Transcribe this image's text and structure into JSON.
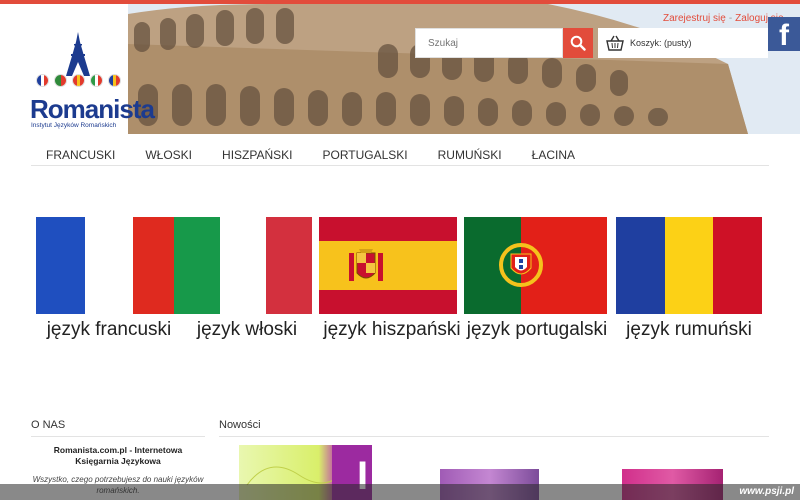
{
  "header": {
    "logo_name": "Romanista",
    "logo_sub": "Instytut Języków Romańskich",
    "logo_flags": [
      {
        "name": "france",
        "colors": [
          "#1f3f9e",
          "#ffffff",
          "#e23a2c"
        ]
      },
      {
        "name": "portugal",
        "colors": [
          "#2f8a3a",
          "#e23a2c"
        ]
      },
      {
        "name": "spain",
        "colors": [
          "#e23a2c",
          "#f6c21c",
          "#e23a2c"
        ]
      },
      {
        "name": "italy",
        "colors": [
          "#2f9a46",
          "#ffffff",
          "#e23a2c"
        ]
      },
      {
        "name": "romania",
        "colors": [
          "#1f3f9e",
          "#f6c21c",
          "#e23a2c"
        ]
      }
    ],
    "auth": {
      "register": "Zarejestruj się",
      "login": "Zaloguj się"
    },
    "search": {
      "placeholder": "Szukaj",
      "icon": "search-icon"
    },
    "cart": {
      "label": "Koszyk: (pusty)",
      "icon": "basket-icon"
    },
    "facebook": {
      "glyph": "f",
      "icon": "facebook-icon"
    }
  },
  "nav": [
    "Francuski",
    "Włoski",
    "Hiszpański",
    "Portugalski",
    "Rumuński",
    "Łacina"
  ],
  "languages": [
    {
      "label": "język francuski",
      "colors": [
        "#1f4fbf",
        "#ffffff",
        "#df2a1f"
      ],
      "emblem": ""
    },
    {
      "label": "język włoski",
      "colors": [
        "#17994a",
        "#ffffff",
        "#d3303e"
      ],
      "emblem": ""
    },
    {
      "label": "język hiszpański",
      "colors": [
        "#c8102e",
        "#f7c21c",
        "#c8102e"
      ],
      "emblem": "spain-coat-of-arms"
    },
    {
      "label": "język portugalski",
      "colors": [
        "#0a6b2e",
        "#e22018"
      ],
      "emblem": "portugal-coat-of-arms"
    },
    {
      "label": "język rumuński",
      "colors": [
        "#1f3fa0",
        "#fcd116",
        "#ce1126"
      ],
      "emblem": ""
    }
  ],
  "about": {
    "title": "O NAS",
    "line1": "Romanista.com.pl - Internetowa Księgarnia Językowa",
    "line2": "Wszystko, czego potrzebujesz do nauki języków romańskich."
  },
  "news": {
    "title": "Nowości"
  },
  "watermark": "www.psji.pl",
  "colors": {
    "accent": "#e24c3b",
    "brand": "#1c3b8f",
    "facebook": "#3b5998"
  }
}
